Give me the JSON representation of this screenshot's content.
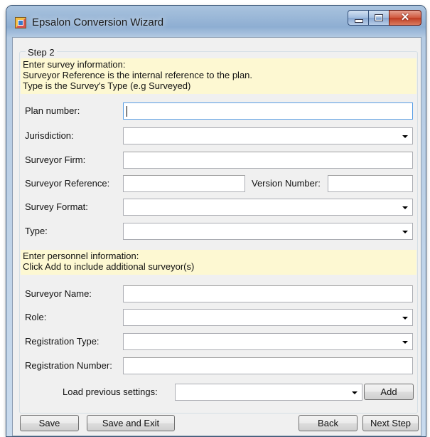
{
  "window": {
    "title": "Epsalon Conversion Wizard"
  },
  "group": {
    "legend": "Step 2"
  },
  "survey_info": {
    "lines": [
      "Enter survey information:",
      "Surveyor Reference is the internal reference to the plan.",
      "Type is the Survey's Type (e.g Surveyed)"
    ]
  },
  "fields": {
    "plan_number": {
      "label": "Plan number:",
      "value": ""
    },
    "jurisdiction": {
      "label": "Jurisdiction:",
      "value": ""
    },
    "surveyor_firm": {
      "label": "Surveyor Firm:",
      "value": ""
    },
    "surveyor_reference": {
      "label": "Surveyor Reference:",
      "value": ""
    },
    "version_number": {
      "label": "Version Number:",
      "value": ""
    },
    "survey_format": {
      "label": "Survey Format:",
      "value": ""
    },
    "type": {
      "label": "Type:",
      "value": ""
    }
  },
  "personnel_info": {
    "lines": [
      "Enter personnel information:",
      "Click Add to include additional surveyor(s)"
    ]
  },
  "personnel": {
    "surveyor_name": {
      "label": "Surveyor Name:",
      "value": ""
    },
    "role": {
      "label": "Role:",
      "value": ""
    },
    "registration_type": {
      "label": "Registration Type:",
      "value": ""
    },
    "registration_number": {
      "label": "Registration Number:",
      "value": ""
    }
  },
  "load_previous": {
    "label": "Load previous settings:",
    "value": "",
    "add_label": "Add"
  },
  "footer": {
    "save": "Save",
    "save_exit": "Save and Exit",
    "back": "Back",
    "next": "Next Step"
  },
  "colors": {
    "info_background": "#fdf8d2",
    "focus_border": "#569de5",
    "close_button": "#c94a30"
  },
  "icons": {
    "app": "app-icon",
    "minimize": "minimize-icon",
    "maximize": "maximize-icon",
    "close": "close-icon",
    "dropdown": "chevron-down-icon"
  }
}
